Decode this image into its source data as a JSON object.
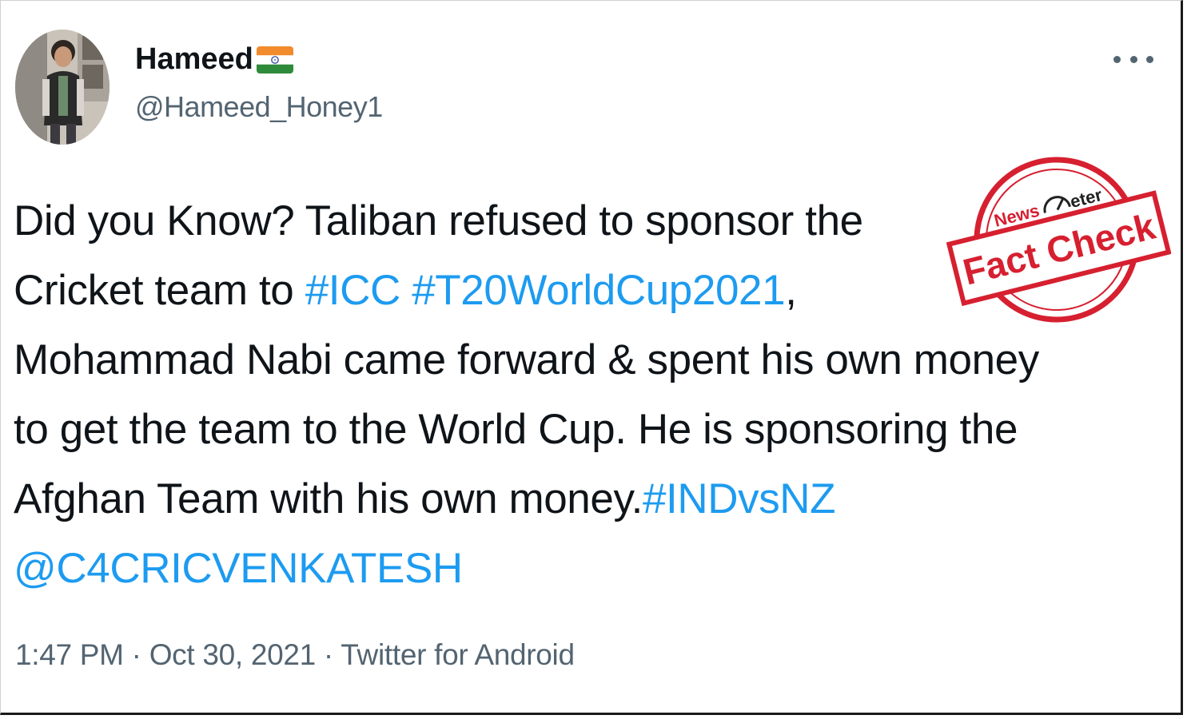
{
  "tweet": {
    "author": {
      "display_name": "Hameed",
      "handle": "@Hameed_Honey1",
      "flag": "India"
    },
    "text_lines": [
      [
        {
          "t": "Did you Know? Taliban refused to sponsor the",
          "link": false
        }
      ],
      [
        {
          "t": "Cricket team to ",
          "link": false
        },
        {
          "t": "#ICC",
          "link": true
        },
        {
          "t": " ",
          "link": false
        },
        {
          "t": "#T20WorldCup2021",
          "link": true
        },
        {
          "t": ",",
          "link": false
        }
      ],
      [
        {
          "t": "Mohammad Nabi came forward & spent his own money",
          "link": false
        }
      ],
      [
        {
          "t": "to get the team to the World Cup. He is sponsoring the",
          "link": false
        }
      ],
      [
        {
          "t": "Afghan Team with his own money.",
          "link": false
        },
        {
          "t": "#INDvsNZ",
          "link": true
        }
      ],
      [
        {
          "t": "@C4CRICVENKATESH",
          "link": true
        }
      ]
    ],
    "time": "1:47 PM",
    "separator": " · ",
    "date": "Oct 30, 2021",
    "source": "Twitter for Android"
  },
  "stamp": {
    "brand_news": "News",
    "brand_meter": "eter",
    "label": "Fact Check",
    "color": "#d62030"
  },
  "icons": {
    "more": "more-options-icon",
    "flag": "india-flag-icon"
  },
  "colors": {
    "text": "#0f1419",
    "secondary": "#536471",
    "link": "#1d9bf0"
  }
}
